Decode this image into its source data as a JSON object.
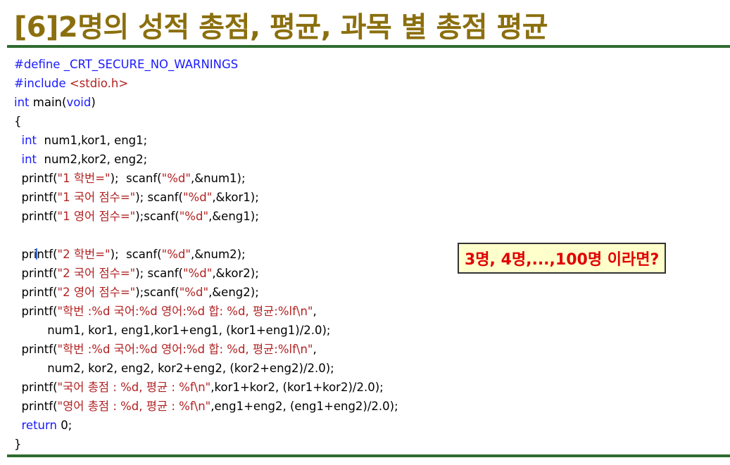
{
  "title": "[6]2명의 성적 총점, 평균, 과목 별 총점 평균",
  "callout": "3명, 4명,...,100명 이라면?",
  "code": {
    "l1": "#define _CRT_SECURE_NO_WARNINGS",
    "l2a": "#include ",
    "l2b": "<stdio.h>",
    "l3a": "int",
    "l3b": " main(",
    "l3c": "void",
    "l3d": ")",
    "l4": "{",
    "l5a": "  ",
    "l5b": "int",
    "l5c": "  num1,kor1, eng1;",
    "l6a": "  ",
    "l6b": "int",
    "l6c": "  num2,kor2, eng2;",
    "l7a": "  printf(",
    "l7b": "\"1 학번=\"",
    "l7c": ");  scanf(",
    "l7d": "\"%d\"",
    "l7e": ",&num1);",
    "l8a": "  printf(",
    "l8b": "\"1 국어 점수=\"",
    "l8c": "); scanf(",
    "l8d": "\"%d\"",
    "l8e": ",&kor1);",
    "l9a": "  printf(",
    "l9b": "\"1 영어 점수=\"",
    "l9c": ");scanf(",
    "l9d": "\"%d\"",
    "l9e": ",&eng1);",
    "l11a": "  pri",
    "l11a2": "ntf(",
    "l11b": "\"2 학번=\"",
    "l11c": ");  scanf(",
    "l11d": "\"%d\"",
    "l11e": ",&num2);",
    "l12a": "  printf(",
    "l12b": "\"2 국어 점수=\"",
    "l12c": "); scanf(",
    "l12d": "\"%d\"",
    "l12e": ",&kor2);",
    "l13a": "  printf(",
    "l13b": "\"2 영어 점수=\"",
    "l13c": ");scanf(",
    "l13d": "\"%d\"",
    "l13e": ",&eng2);",
    "l14a": "  printf(",
    "l14b": "\"학번 :%d 국어:%d 영어:%d 합: %d, 평균:%lf\\n\"",
    "l14c": ",",
    "l15": "         num1, kor1, eng1,kor1+eng1, (kor1+eng1)/2.0);",
    "l16a": "  printf(",
    "l16b": "\"학번 :%d 국어:%d 영어:%d 합: %d, 평균:%lf\\n\"",
    "l16c": ",",
    "l17": "         num2, kor2, eng2, kor2+eng2, (kor2+eng2)/2.0);",
    "l18a": "  printf(",
    "l18b": "\"국어 총점 : %d, 평균 : %f\\n\"",
    "l18c": ",kor1+kor2, (kor1+kor2)/2.0);",
    "l19a": "  printf(",
    "l19b": "\"영어 총점 : %d, 평균 : %f\\n\"",
    "l19c": ",eng1+eng2, (eng1+eng2)/2.0);",
    "l20a": "  ",
    "l20b": "return",
    "l20c": " 0;",
    "l21": "}"
  },
  "colors": {
    "title": "#8B6F0E",
    "rule": "#2E6B2F",
    "keyword": "#1a1aff",
    "string": "#b22222",
    "callout_text": "#E00000",
    "callout_bg": "#FFFFCC"
  }
}
